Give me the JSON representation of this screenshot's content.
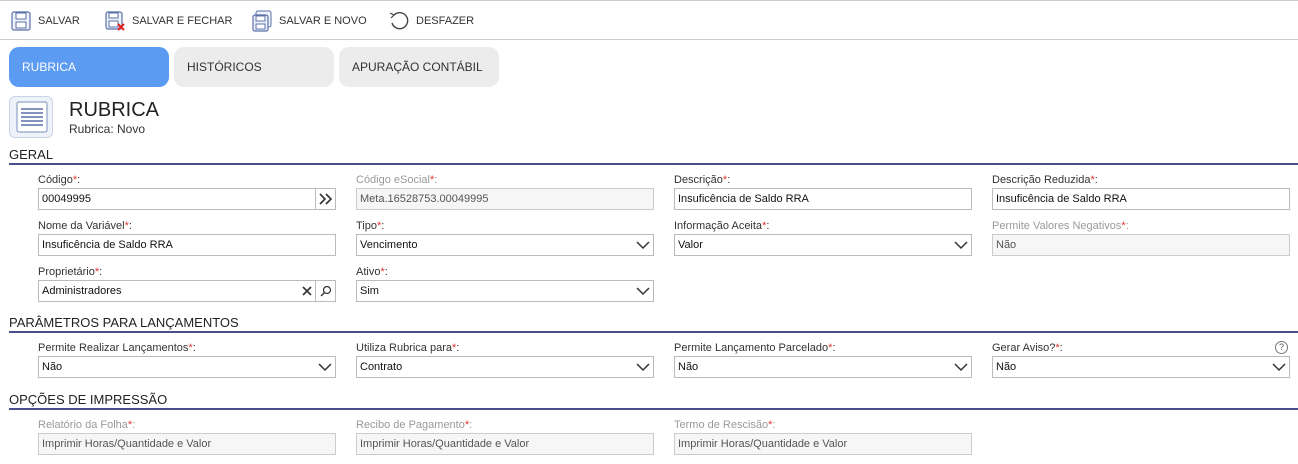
{
  "toolbar": {
    "save": "SALVAR",
    "save_close": "SALVAR E FECHAR",
    "save_new": "SALVAR E NOVO",
    "undo": "DESFAZER"
  },
  "tabs": [
    {
      "label": "RUBRICA",
      "active": true
    },
    {
      "label": "HISTÓRICOS",
      "active": false
    },
    {
      "label": "APURAÇÃO CONTÁBIL",
      "active": false
    }
  ],
  "header": {
    "title": "RUBRICA",
    "subtitle": "Rubrica: Novo"
  },
  "sections": {
    "geral": "GERAL",
    "parametros": "PARÂMETROS PARA LANÇAMENTOS",
    "impressao": "OPÇÕES DE IMPRESSÃO"
  },
  "fields": {
    "codigo": {
      "label": "Código",
      "value": "00049995"
    },
    "codigo_esocial": {
      "label": "Código eSocial",
      "value": "Meta.16528753.00049995"
    },
    "descricao": {
      "label": "Descrição",
      "value": "Insuficência de Saldo RRA"
    },
    "descricao_reduzida": {
      "label": "Descrição Reduzida",
      "value": "Insuficência de Saldo RRA"
    },
    "nome_variavel": {
      "label": "Nome da Variável",
      "value": "Insuficência de Saldo RRA"
    },
    "tipo": {
      "label": "Tipo",
      "value": "Vencimento"
    },
    "informacao_aceita": {
      "label": "Informação Aceita",
      "value": "Valor"
    },
    "permite_negativos": {
      "label": "Permite Valores Negativos",
      "value": "Não"
    },
    "proprietario": {
      "label": "Proprietário",
      "value": "Administradores"
    },
    "ativo": {
      "label": "Ativo",
      "value": "Sim"
    },
    "permite_lancamentos": {
      "label": "Permite Realizar Lançamentos",
      "value": "Não"
    },
    "utiliza_rubrica": {
      "label": "Utiliza Rubrica para",
      "value": "Contrato"
    },
    "permite_parcelado": {
      "label": "Permite Lançamento Parcelado",
      "value": "Não"
    },
    "gerar_aviso": {
      "label": "Gerar Aviso?",
      "value": "Não"
    },
    "relatorio_folha": {
      "label": "Relatório da Folha",
      "value": "Imprimir Horas/Quantidade e Valor"
    },
    "recibo_pagamento": {
      "label": "Recibo de Pagamento",
      "value": "Imprimir Horas/Quantidade e Valor"
    },
    "termo_rescisao": {
      "label": "Termo de Rescisão",
      "value": "Imprimir Horas/Quantidade e Valor"
    }
  },
  "required_mark": "*",
  "help_glyph": "?"
}
